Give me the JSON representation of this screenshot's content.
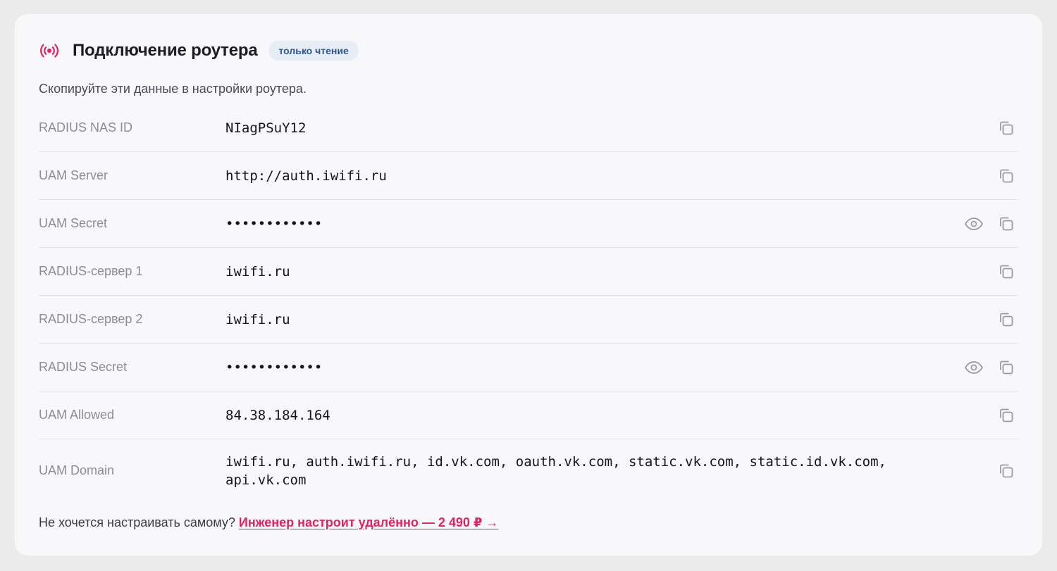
{
  "header": {
    "title": "Подключение роутера",
    "badge": "только чтение",
    "accent_color": "#e0245e",
    "icon": "radio-signal-icon"
  },
  "subtitle": "Скопируйте эти данные в настройки роутера.",
  "rows": [
    {
      "label": "RADIUS NAS ID",
      "value": "NIagPSuY12",
      "secret": false
    },
    {
      "label": "UAM Server",
      "value": "http://auth.iwifi.ru",
      "secret": false
    },
    {
      "label": "UAM Secret",
      "value": "••••••••••••",
      "secret": true
    },
    {
      "label": "RADIUS-сервер 1",
      "value": "iwifi.ru",
      "secret": false
    },
    {
      "label": "RADIUS-сервер 2",
      "value": "iwifi.ru",
      "secret": false
    },
    {
      "label": "RADIUS Secret",
      "value": "••••••••••••",
      "secret": true
    },
    {
      "label": "UAM Allowed",
      "value": "84.38.184.164",
      "secret": false
    },
    {
      "label": "UAM Domain",
      "value": "iwifi.ru, auth.iwifi.ru, id.vk.com, oauth.vk.com, static.vk.com, static.id.vk.com, api.vk.com",
      "secret": false
    }
  ],
  "footer": {
    "prompt": "Не хочется настраивать самому?",
    "link": "Инженер настроит удалённо — 2 490 ₽ →"
  }
}
